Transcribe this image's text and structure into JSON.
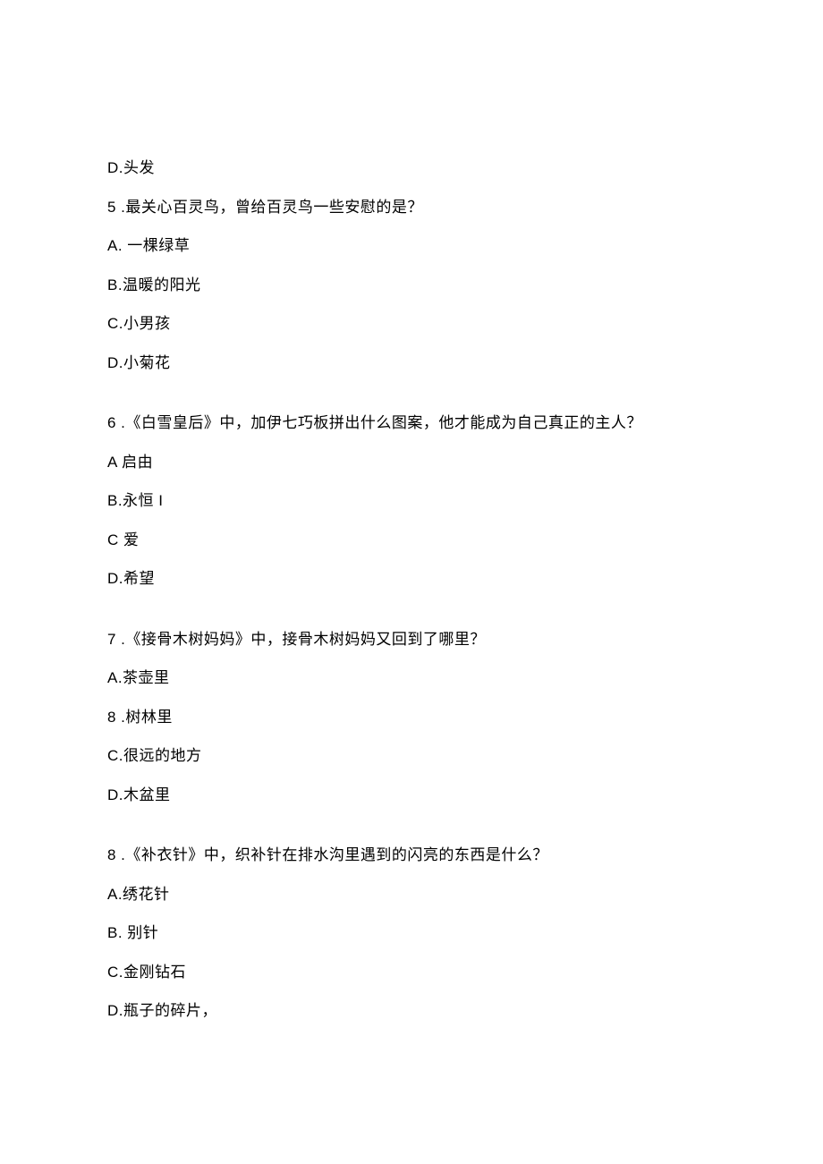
{
  "lines": {
    "q4_d": "D.头发",
    "q5_text": "5 .最关心百灵鸟，曾给百灵鸟一些安慰的是？",
    "q5_a": "A. 一棵绿草",
    "q5_b": "B.温暖的阳光",
    "q5_c": "C.小男孩",
    "q5_d": "D.小菊花",
    "q6_text": "6 .《白雪皇后》中，加伊七巧板拼出什么图案，他才能成为自己真正的主人？",
    "q6_a": "A 启由",
    "q6_b": "B.永恒 I",
    "q6_c": "C 爱",
    "q6_d": "D.希望",
    "q7_text": "7 .《接骨木树妈妈》中，接骨木树妈妈又回到了哪里？",
    "q7_a": "A.茶壶里",
    "q7_item8": "8   .树林里",
    "q7_c": "C.很远的地方",
    "q7_d": "D.木盆里",
    "q8_text": "8 .《补衣针》中，织补针在排水沟里遇到的闪亮的东西是什么？",
    "q8_a": "A.绣花针",
    "q8_b": "B. 别针",
    "q8_c": "C.金刚钻石",
    "q8_d": "D.瓶子的碎片，"
  }
}
